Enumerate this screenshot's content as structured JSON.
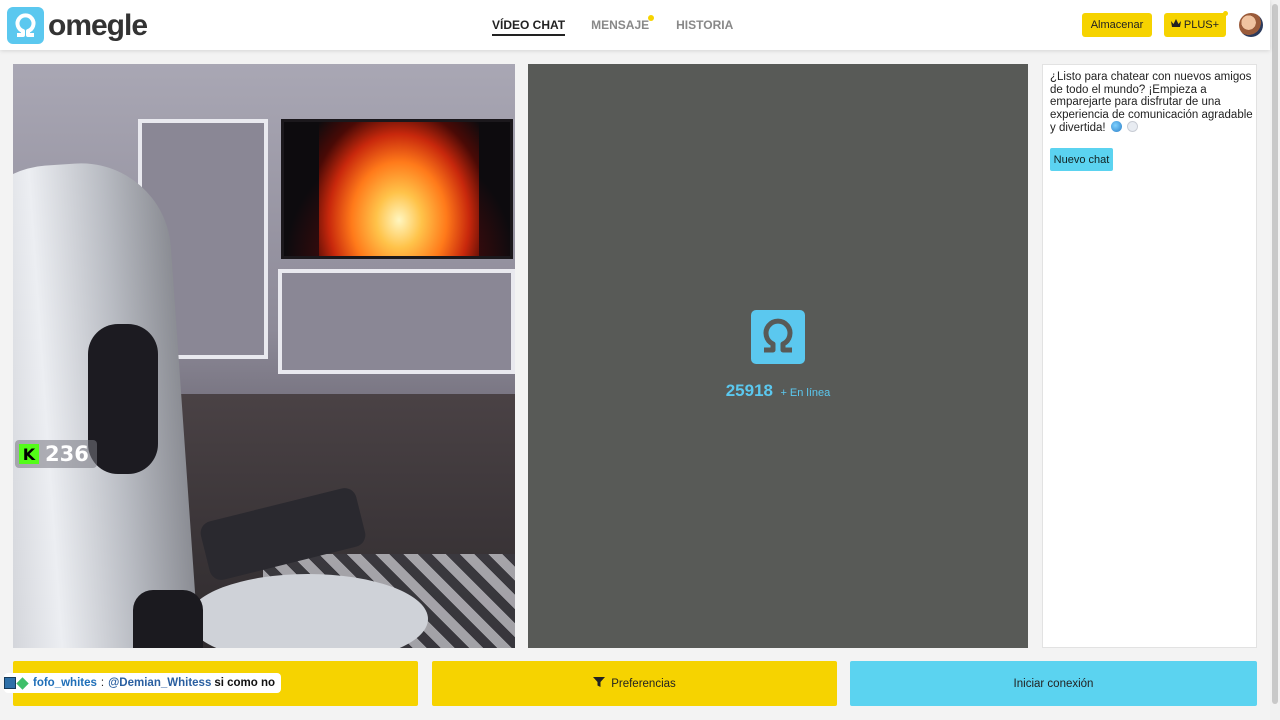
{
  "app": {
    "logo_text": "omegle"
  },
  "nav": {
    "items": [
      {
        "label": "VÍDEO CHAT",
        "active": true
      },
      {
        "label": "MENSAJE",
        "active": false,
        "dot": true
      },
      {
        "label": "HISTORIA",
        "active": false
      }
    ]
  },
  "header": {
    "store_label": "Almacenar",
    "plus_label": "PLUS+",
    "plus_icon": "crown-icon"
  },
  "local_video": {
    "overlay_icon": "kick-icon",
    "overlay_letter": "K",
    "viewer_count": "236"
  },
  "remote_video": {
    "online_count": "25918",
    "online_label": "+ En línea"
  },
  "chat": {
    "message": "¿Listo para chatear con nuevos amigos de todo el mundo? ¡Empieza a emparejarte para disfrutar de una experiencia de comunicación agradable y divertida!",
    "new_chat_label": "Nuevo chat"
  },
  "bottom": {
    "preferences_label": "Preferencias",
    "preferences_icon": "filter-icon",
    "connect_label": "Iniciar conexión"
  },
  "stream_chat": {
    "user": "fofo_whites",
    "separator": ":",
    "mention": "@Demian_Whitess",
    "text": "si como no"
  },
  "colors": {
    "accent_yellow": "#f6d300",
    "accent_blue": "#5bc8ef",
    "button_blue": "#5bd3f0",
    "remote_bg": "#585a57"
  }
}
